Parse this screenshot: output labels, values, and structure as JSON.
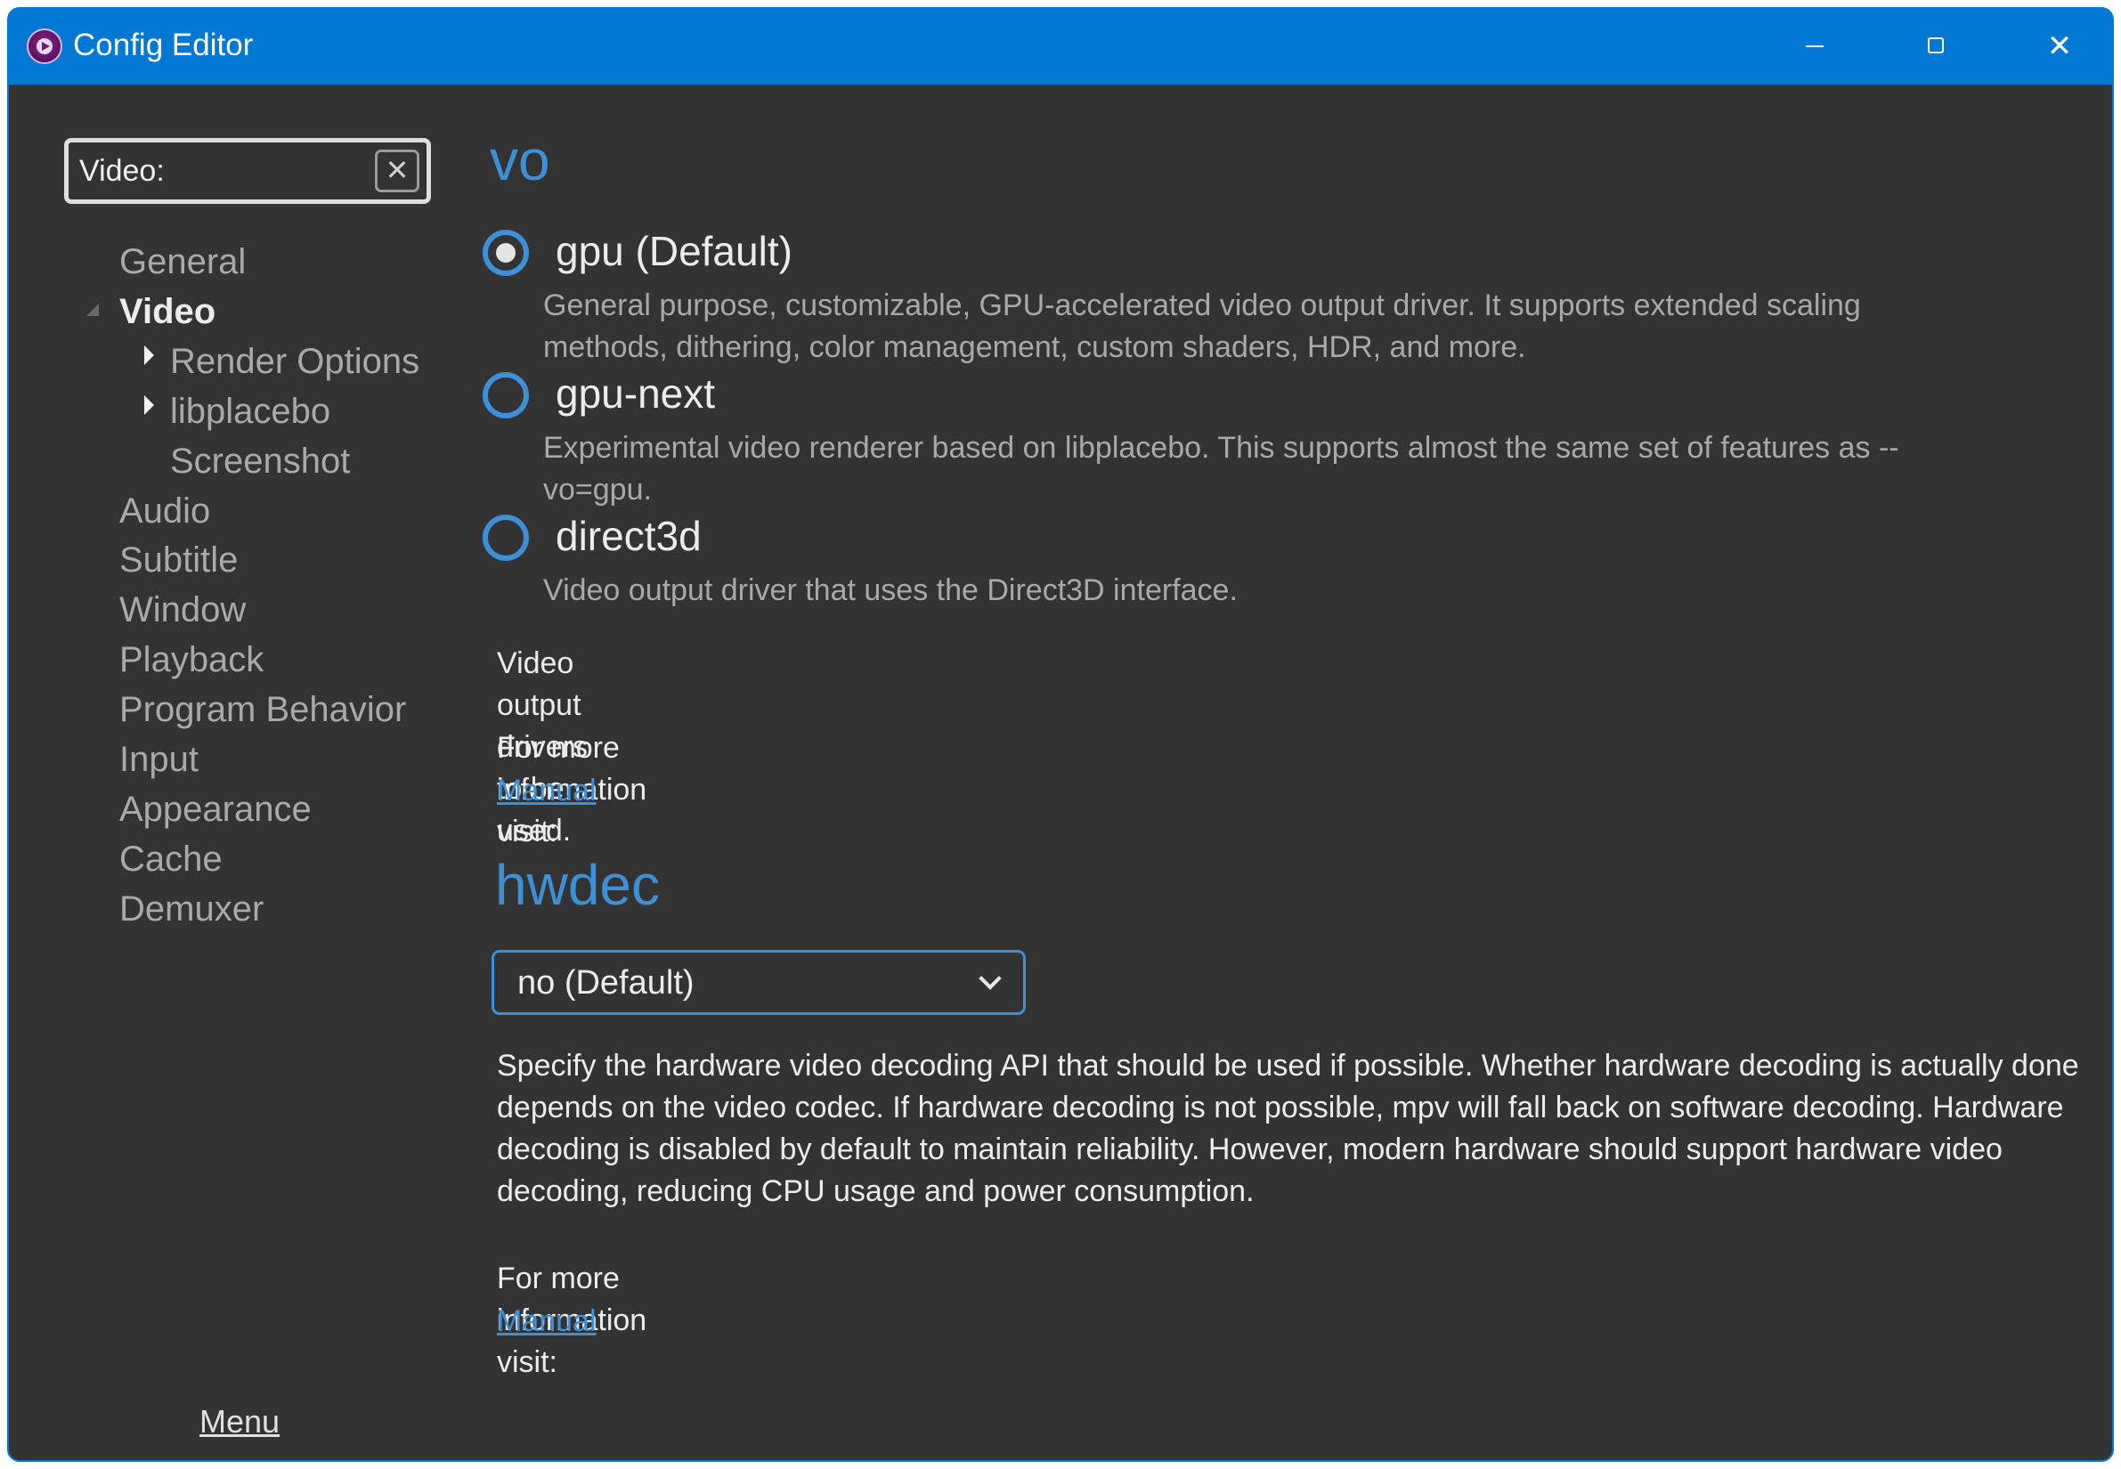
{
  "window": {
    "title": "Config Editor",
    "controls": {
      "minimize": "minimize",
      "maximize": "maximize",
      "close": "close"
    }
  },
  "search": {
    "value": "Video:",
    "placeholder": "",
    "clear_glyph": "✕"
  },
  "sidebar": {
    "items": [
      {
        "label": "General",
        "level": 0,
        "selected": false
      },
      {
        "label": "Video",
        "level": 0,
        "selected": true,
        "expanded": true
      },
      {
        "label": "Render Options",
        "level": 1,
        "expandable": true
      },
      {
        "label": "libplacebo",
        "level": 1,
        "expandable": true
      },
      {
        "label": "Screenshot",
        "level": 1
      },
      {
        "label": "Audio",
        "level": 0
      },
      {
        "label": "Subtitle",
        "level": 0
      },
      {
        "label": "Window",
        "level": 0
      },
      {
        "label": "Playback",
        "level": 0
      },
      {
        "label": "Program Behavior",
        "level": 0
      },
      {
        "label": "Input",
        "level": 0
      },
      {
        "label": "Appearance",
        "level": 0
      },
      {
        "label": "Cache",
        "level": 0
      },
      {
        "label": "Demuxer",
        "level": 0
      }
    ],
    "menu_label": "Menu"
  },
  "sections": {
    "vo": {
      "title": "vo",
      "options": [
        {
          "label": "gpu (Default)",
          "checked": true,
          "description": "General purpose, customizable, GPU-accelerated video output driver. It supports extended scaling methods, dithering, color management, custom shaders, HDR, and more."
        },
        {
          "label": "gpu-next",
          "checked": false,
          "description": "Experimental video renderer based on libplacebo. This supports almost the same set of features as --vo=gpu."
        },
        {
          "label": "direct3d",
          "checked": false,
          "description": "Video output driver that uses the Direct3D interface."
        }
      ],
      "help": "Video output drivers to be used.",
      "more_info": "For more information visit:",
      "link_label": "Manual"
    },
    "hwdec": {
      "title": "hwdec",
      "selected_value": "no (Default)",
      "help": "Specify the hardware video decoding API that should be used if possible. Whether hardware decoding is actually done depends on the video codec. If hardware decoding is not possible, mpv will fall back on software decoding. Hardware decoding is disabled by default to maintain reliability. However, modern hardware should support hardware video decoding, reducing CPU usage and power consumption.",
      "more_info": "For more information visit:",
      "link_label": "Manual"
    }
  },
  "colors": {
    "titlebar": "#0078d4",
    "background": "#333333",
    "accent": "#3d8fd6",
    "text_primary": "#ececec",
    "text_secondary": "#a9a9a9"
  }
}
